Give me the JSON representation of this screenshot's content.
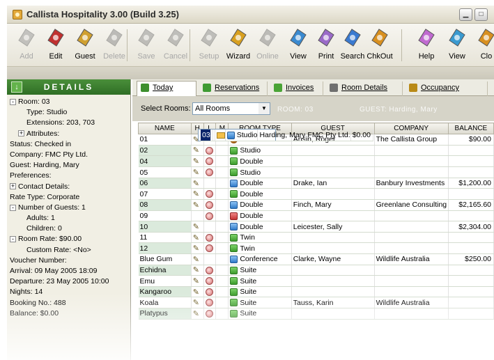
{
  "window": {
    "title": "Callista Hospitality 3.00 (Build 3.25)"
  },
  "toolbar": [
    {
      "label": "Add",
      "enabled": false,
      "icon": "add-icon"
    },
    {
      "label": "Edit",
      "enabled": true,
      "icon": "edit-icon"
    },
    {
      "label": "Guest",
      "enabled": true,
      "icon": "guest-icon"
    },
    {
      "label": "Delete",
      "enabled": false,
      "icon": "delete-icon"
    },
    {
      "label": "Save",
      "enabled": false,
      "icon": "save-icon"
    },
    {
      "label": "Cancel",
      "enabled": false,
      "icon": "cancel-icon"
    },
    {
      "label": "Setup",
      "enabled": false,
      "icon": "setup-gear-icon"
    },
    {
      "label": "Wizard",
      "enabled": true,
      "icon": "wizard-icon"
    },
    {
      "label": "Online",
      "enabled": false,
      "icon": "online-icon"
    },
    {
      "label": "View",
      "enabled": true,
      "icon": "view-icon"
    },
    {
      "label": "Print",
      "enabled": true,
      "icon": "print-icon"
    },
    {
      "label": "Search",
      "enabled": true,
      "icon": "search-icon"
    },
    {
      "label": "ChkOut",
      "enabled": true,
      "icon": "checkout-icon"
    },
    {
      "label": "Help",
      "enabled": true,
      "icon": "help-icon"
    },
    {
      "label": "View",
      "enabled": true,
      "icon": "view2-icon"
    },
    {
      "label": "Clo",
      "enabled": true,
      "icon": "close-door-icon"
    }
  ],
  "details": {
    "header": "DETAILS",
    "items": [
      {
        "text": "Room: 03",
        "indent": 0,
        "toggle": "-"
      },
      {
        "text": "Type: Studio",
        "indent": 2,
        "toggle": ""
      },
      {
        "text": "Extensions: 203, 703",
        "indent": 2,
        "toggle": ""
      },
      {
        "text": "Attributes:",
        "indent": 1,
        "toggle": "+"
      },
      {
        "text": "Status: Checked in",
        "indent": 0,
        "toggle": ""
      },
      {
        "text": "Company: FMC Pty Ltd.",
        "indent": 0,
        "toggle": ""
      },
      {
        "text": "Guest: Harding, Mary",
        "indent": 0,
        "toggle": ""
      },
      {
        "text": "Preferences:",
        "indent": 0,
        "toggle": ""
      },
      {
        "text": "Contact Details:",
        "indent": 0,
        "toggle": "+"
      },
      {
        "text": "Rate Type: Corporate",
        "indent": 0,
        "toggle": ""
      },
      {
        "text": "Number of Guests: 1",
        "indent": 0,
        "toggle": "-"
      },
      {
        "text": "Adults: 1",
        "indent": 2,
        "toggle": ""
      },
      {
        "text": "Children: 0",
        "indent": 2,
        "toggle": ""
      },
      {
        "text": "Room Rate: $90.00",
        "indent": 0,
        "toggle": "-"
      },
      {
        "text": "Custom Rate: <No>",
        "indent": 2,
        "toggle": ""
      },
      {
        "text": "Voucher Number:",
        "indent": 0,
        "toggle": ""
      },
      {
        "text": "Arrival:      09 May 2005 18:09",
        "indent": 0,
        "toggle": ""
      },
      {
        "text": "Departure: 23 May 2005 10:00",
        "indent": 0,
        "toggle": ""
      },
      {
        "text": "Nights: 14",
        "indent": 0,
        "toggle": ""
      },
      {
        "text": "Booking No.: 488",
        "indent": 0,
        "toggle": ""
      },
      {
        "text": "Balance: $0.00",
        "indent": 0,
        "toggle": ""
      }
    ]
  },
  "tabs": [
    {
      "label": "Today",
      "active": true,
      "color": "#3d8f2e"
    },
    {
      "label": "Reservations",
      "active": false,
      "color": "#3f9a33"
    },
    {
      "label": "Invoices",
      "active": false,
      "color": "#4aa436"
    },
    {
      "label": "Room Details",
      "active": false,
      "color": "#6f6f6f"
    },
    {
      "label": "Occupancy",
      "active": false,
      "color": "#b98a17"
    }
  ],
  "filter": {
    "label": "Select Rooms:",
    "value": "All Rooms",
    "room_info": "ROOM: 03",
    "guest_info": "GUEST: Harding, Mary"
  },
  "grid": {
    "columns": [
      "NAME",
      "H",
      "L",
      "M",
      "ROOM TYPE",
      "GUEST",
      "COMPANY",
      "BALANCE"
    ],
    "rows": [
      {
        "name": "01",
        "h": true,
        "l": false,
        "m": false,
        "status": "dark",
        "type": "Studio",
        "guest": "Ansin, Roger",
        "company": "The Callista Group",
        "balance": "$90.00"
      },
      {
        "name": "02",
        "h": true,
        "l": true,
        "m": false,
        "status": "green",
        "type": "Studio",
        "guest": "",
        "company": "",
        "balance": ""
      },
      {
        "name": "03",
        "h": false,
        "l": false,
        "m": true,
        "status": "blue",
        "type": "Studio",
        "guest": "Harding, Mary",
        "company": "FMC Pty Ltd.",
        "balance": "$0.00",
        "selected": true
      },
      {
        "name": "04",
        "h": true,
        "l": true,
        "m": false,
        "status": "green",
        "type": "Double",
        "guest": "",
        "company": "",
        "balance": ""
      },
      {
        "name": "05",
        "h": true,
        "l": true,
        "m": false,
        "status": "green",
        "type": "Studio",
        "guest": "",
        "company": "",
        "balance": ""
      },
      {
        "name": "06",
        "h": true,
        "l": false,
        "m": false,
        "status": "blue",
        "type": "Double",
        "guest": "Drake, Ian",
        "company": "Banbury Investments",
        "balance": "$1,200.00"
      },
      {
        "name": "07",
        "h": true,
        "l": true,
        "m": false,
        "status": "green",
        "type": "Double",
        "guest": "",
        "company": "",
        "balance": ""
      },
      {
        "name": "08",
        "h": true,
        "l": true,
        "m": false,
        "status": "blue",
        "type": "Double",
        "guest": "Finch, Mary",
        "company": "Greenlane Consulting",
        "balance": "$2,165.60"
      },
      {
        "name": "09",
        "h": false,
        "l": true,
        "m": false,
        "status": "red",
        "type": "Double",
        "guest": "",
        "company": "",
        "balance": ""
      },
      {
        "name": "10",
        "h": true,
        "l": false,
        "m": false,
        "status": "blue",
        "type": "Double",
        "guest": "Leicester, Sally",
        "company": "",
        "balance": "$2,304.00"
      },
      {
        "name": "11",
        "h": true,
        "l": true,
        "m": false,
        "status": "green",
        "type": "Twin",
        "guest": "",
        "company": "",
        "balance": ""
      },
      {
        "name": "12",
        "h": true,
        "l": true,
        "m": false,
        "status": "green",
        "type": "Twin",
        "guest": "",
        "company": "",
        "balance": ""
      },
      {
        "name": "Blue Gum",
        "h": true,
        "l": false,
        "m": false,
        "status": "blue",
        "type": "Conference",
        "guest": "Clarke, Wayne",
        "company": "Wildlife Australia",
        "balance": "$250.00"
      },
      {
        "name": "Echidna",
        "h": true,
        "l": true,
        "m": false,
        "status": "green",
        "type": "Suite",
        "guest": "",
        "company": "",
        "balance": ""
      },
      {
        "name": "Emu",
        "h": true,
        "l": true,
        "m": false,
        "status": "green",
        "type": "Suite",
        "guest": "",
        "company": "",
        "balance": ""
      },
      {
        "name": "Kangaroo",
        "h": true,
        "l": true,
        "m": false,
        "status": "green",
        "type": "Suite",
        "guest": "",
        "company": "",
        "balance": ""
      },
      {
        "name": "Koala",
        "h": true,
        "l": true,
        "m": false,
        "status": "green",
        "type": "Suite",
        "guest": "Tauss, Karin",
        "company": "Wildlife Australia",
        "balance": ""
      },
      {
        "name": "Platypus",
        "h": true,
        "l": true,
        "m": false,
        "status": "green",
        "type": "Suite",
        "guest": "",
        "company": "",
        "balance": ""
      }
    ]
  }
}
